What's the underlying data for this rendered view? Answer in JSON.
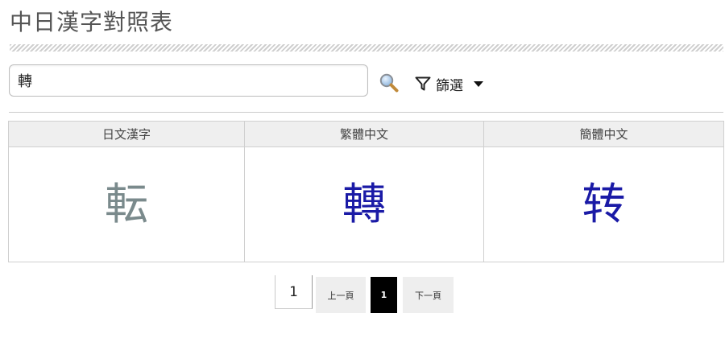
{
  "page": {
    "title": "中日漢字對照表"
  },
  "search": {
    "value": "轉",
    "placeholder": ""
  },
  "filter": {
    "label": "篩選",
    "icon": "filter-icon",
    "caret_icon": "caret-down-icon"
  },
  "search_button": {
    "icon": "magnifier-icon"
  },
  "table": {
    "columns": [
      "日文漢字",
      "繁體中文",
      "簡體中文"
    ],
    "rows": [
      {
        "japanese": "転",
        "traditional": "轉",
        "simplified": "转"
      }
    ],
    "colors": {
      "japanese": "#7a8a8c",
      "traditional": "#1a1aa6",
      "simplified": "#1a1aa6"
    }
  },
  "pagination": {
    "page_input_value": "1",
    "prev_label": "上一頁",
    "current_page": "1",
    "next_label": "下一頁"
  }
}
